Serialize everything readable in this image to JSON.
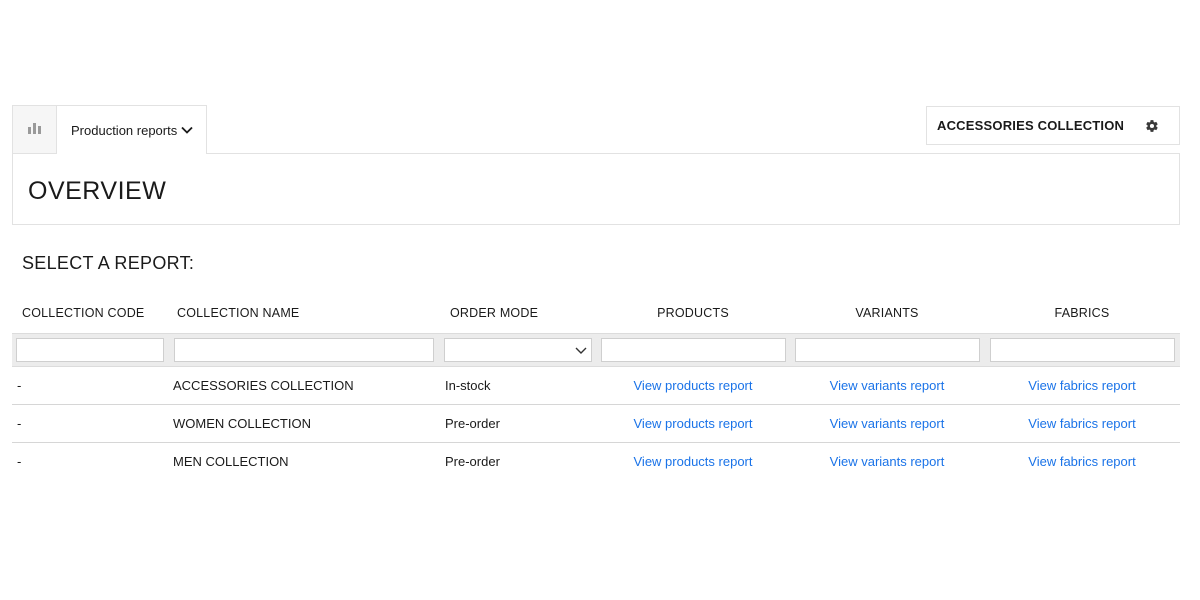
{
  "tabs": {
    "chart_icon": "bar-chart-icon",
    "reports_label": "Production reports",
    "reports_chevron_icon": "chevron-down-icon"
  },
  "collection_selector": {
    "title": "ACCESSORIES COLLECTION",
    "settings_icon": "gear-icon"
  },
  "overview": {
    "title": "OVERVIEW"
  },
  "select_heading": "SELECT A REPORT:",
  "table": {
    "headers": {
      "code": "COLLECTION CODE",
      "name": "COLLECTION NAME",
      "order_mode": "ORDER MODE",
      "products": "PRODUCTS",
      "variants": "VARIANTS",
      "fabrics": "FABRICS"
    },
    "filters": {
      "code": "",
      "name": "",
      "order_mode": "",
      "products": "",
      "variants": "",
      "fabrics": ""
    },
    "rows": [
      {
        "code": "-",
        "name": "ACCESSORIES COLLECTION",
        "order_mode": "In-stock",
        "products": "View products report",
        "variants": "View variants report",
        "fabrics": "View fabrics report"
      },
      {
        "code": "-",
        "name": "WOMEN COLLECTION",
        "order_mode": "Pre-order",
        "products": "View products report",
        "variants": "View variants report",
        "fabrics": "View fabrics report"
      },
      {
        "code": "-",
        "name": "MEN COLLECTION",
        "order_mode": "Pre-order",
        "products": "View products report",
        "variants": "View variants report",
        "fabrics": "View fabrics report"
      }
    ]
  },
  "colors": {
    "link": "#1a73e8",
    "border": "#e2e2e2",
    "filter_bg": "#ececec"
  }
}
